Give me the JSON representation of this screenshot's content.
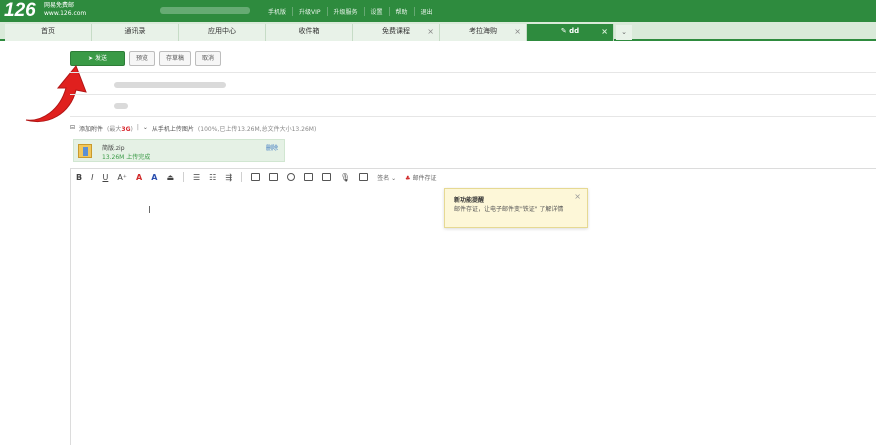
{
  "brand": {
    "logo_num": "126",
    "logo_line1": "网易免费邮",
    "logo_line2": "www.126.com"
  },
  "top_links": [
    "手机版",
    "升级VIP",
    "升级服务",
    "设置",
    "帮助",
    "退出"
  ],
  "tabs": [
    {
      "label": "首页",
      "closable": false,
      "active": false
    },
    {
      "label": "通讯录",
      "closable": false,
      "active": false
    },
    {
      "label": "应用中心",
      "closable": false,
      "active": false
    },
    {
      "label": "收件箱",
      "closable": false,
      "active": false
    },
    {
      "label": "免费课程",
      "closable": true,
      "active": false
    },
    {
      "label": "考拉海购",
      "closable": true,
      "active": false
    },
    {
      "label": "dd",
      "closable": true,
      "active": true
    }
  ],
  "toolbar": {
    "send": "发送",
    "preview": "预览",
    "save_draft": "存草稿",
    "cancel": "取消"
  },
  "attachment": {
    "add_label": "添加附件",
    "limit_prefix": "(最大",
    "limit_value": "3G",
    "limit_suffix": ")",
    "phone_upload": "从手机上传图片",
    "summary": "(100%,已上传13.26M,总文件大小13.26M)"
  },
  "file": {
    "name": "简版.zip",
    "status": "13.26M 上传完成",
    "delete": "删除"
  },
  "format_toolbar": {
    "signature": "签名",
    "certify": "邮件存证"
  },
  "tooltip": {
    "title": "新功能提醒",
    "body": "邮件存证，让电子邮件变\"铁证\" 了解详情",
    "close": "×"
  },
  "colors": {
    "brand_green": "#2e8b3e",
    "send_green": "#3a9a46",
    "arrow_red": "#e0201e"
  }
}
